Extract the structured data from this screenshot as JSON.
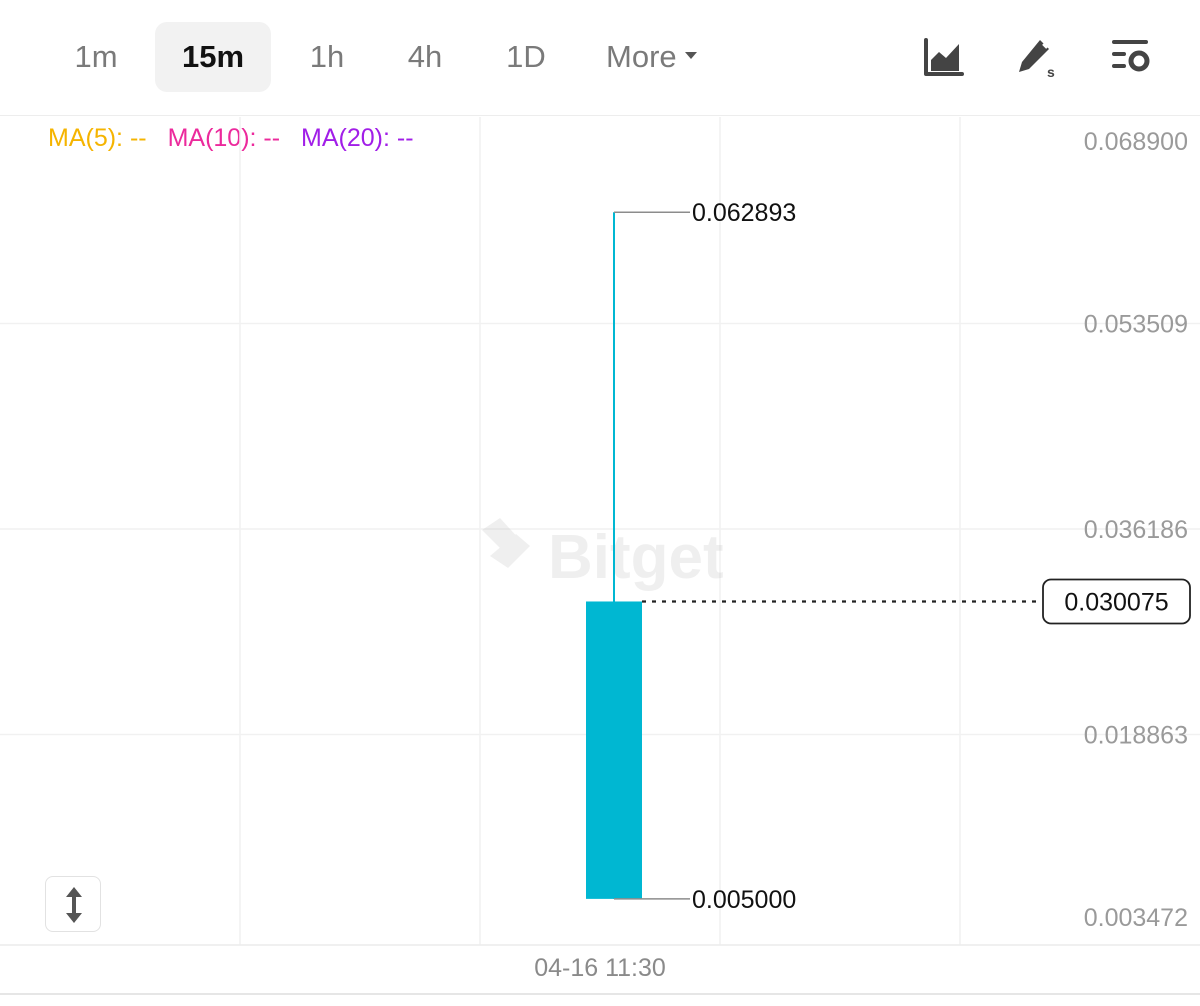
{
  "toolbar": {
    "timeframes": [
      {
        "label": "1m",
        "active": false
      },
      {
        "label": "15m",
        "active": true
      },
      {
        "label": "1h",
        "active": false
      },
      {
        "label": "4h",
        "active": false
      },
      {
        "label": "1D",
        "active": false
      }
    ],
    "more_label": "More",
    "icons": [
      "area-chart-icon",
      "draw-tools-icon",
      "chart-settings-icon"
    ]
  },
  "indicators": [
    {
      "label": "MA(5): --",
      "color": "#f5b400"
    },
    {
      "label": "MA(10): --",
      "color": "#ec2a9c"
    },
    {
      "label": "MA(20): --",
      "color": "#a11ee8"
    }
  ],
  "watermark": "Bitget",
  "colors": {
    "candle": "#00b7d2",
    "axis_text": "#9a9a9a",
    "grid": "#f1f1f1"
  },
  "chart_data": {
    "type": "candlestick",
    "y_ticks": [
      "0.068900",
      "0.053509",
      "0.036186",
      "0.018863",
      "0.003472"
    ],
    "x_ticks": [
      "04-16 11:30"
    ],
    "candles": [
      {
        "time": "04-16 11:30",
        "open": 0.005,
        "high": 0.062893,
        "low": 0.005,
        "close": 0.030075
      }
    ],
    "high_label": "0.062893",
    "low_label": "0.005000",
    "last_price": 0.030075,
    "last_price_label": "0.030075"
  }
}
